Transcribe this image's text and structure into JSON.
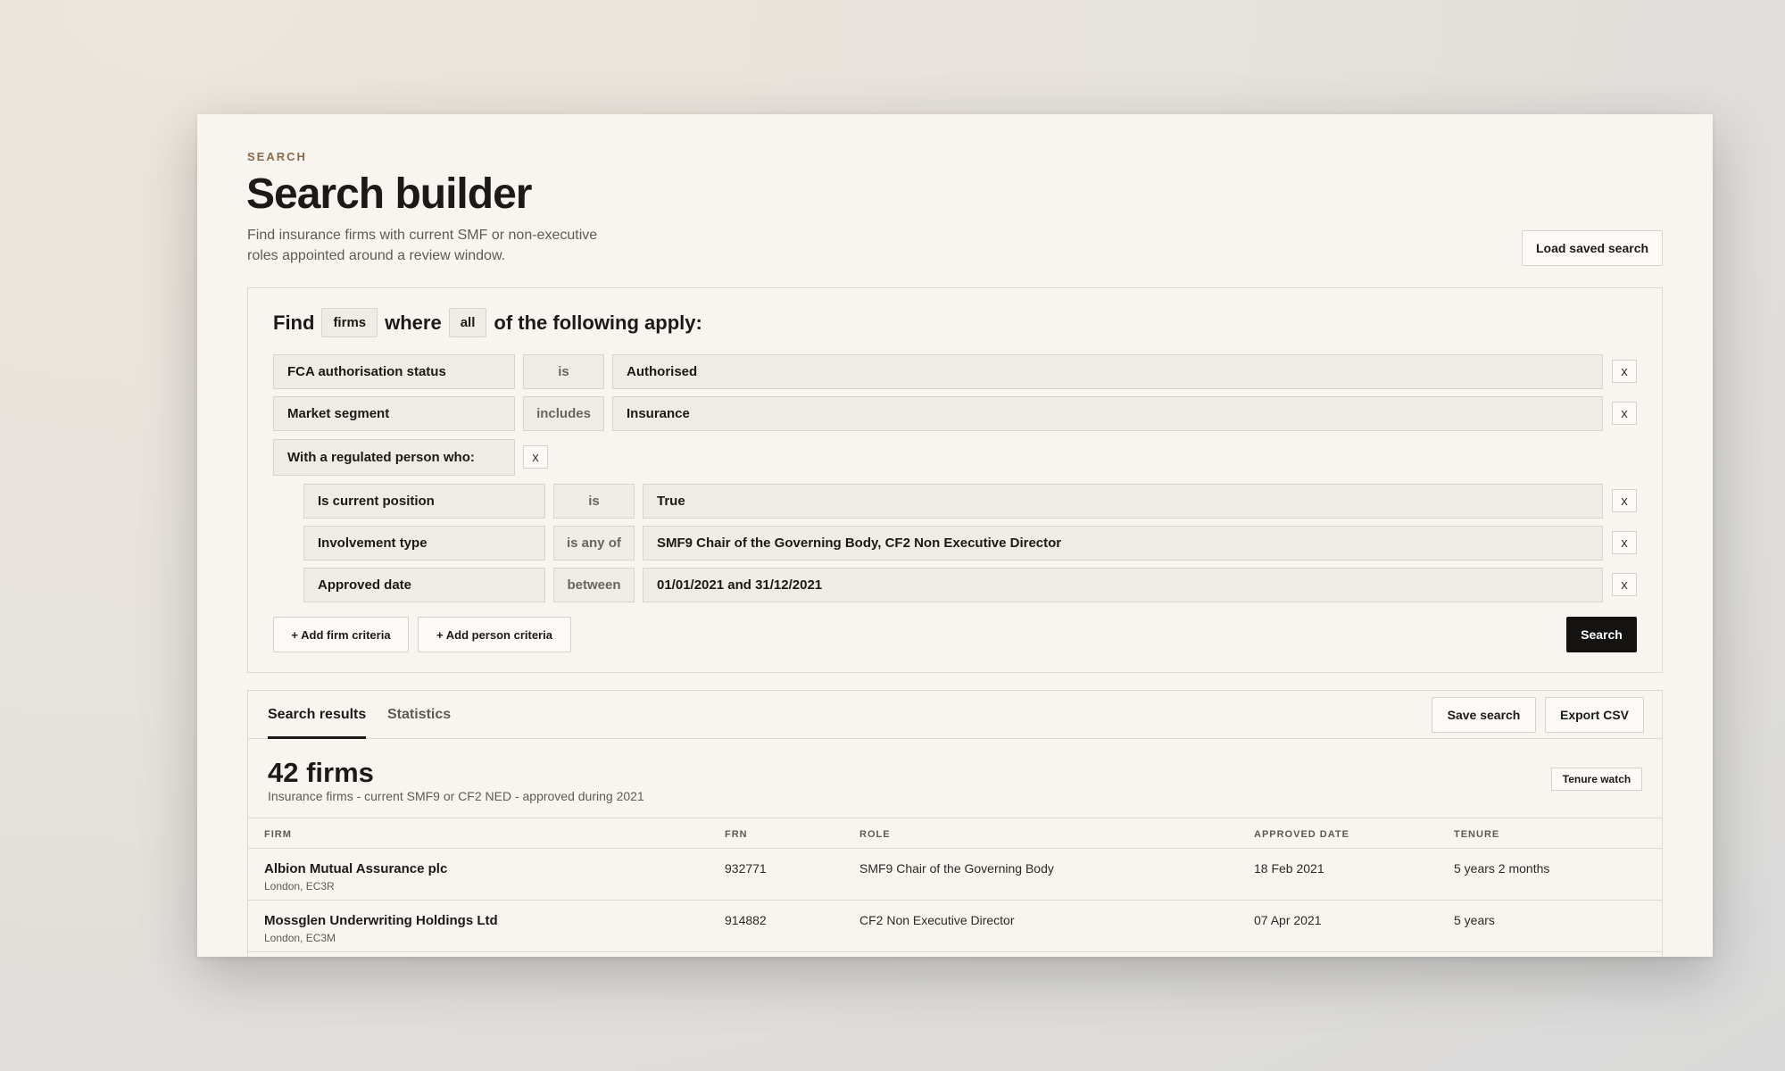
{
  "header": {
    "eyebrow": "SEARCH",
    "title": "Search builder",
    "subtitle": "Find insurance firms with current SMF or non-executive roles appointed around a review window.",
    "load_saved_label": "Load saved search"
  },
  "builder": {
    "find": "Find",
    "entity": "firms",
    "where": "where",
    "quantifier": "all",
    "suffix": "of the following apply:",
    "firm_criteria": [
      {
        "field": "FCA authorisation status",
        "operator": "is",
        "value": "Authorised"
      },
      {
        "field": "Market segment",
        "operator": "includes",
        "value": "Insurance"
      }
    ],
    "group_label": "With a regulated person who:",
    "person_criteria": [
      {
        "field": "Is current position",
        "operator": "is",
        "value": "True"
      },
      {
        "field": "Involvement type",
        "operator": "is any of",
        "value": "SMF9 Chair of the Governing Body, CF2 Non Executive Director"
      },
      {
        "field": "Approved date",
        "operator": "between",
        "value": "01/01/2021 and 31/12/2021"
      }
    ],
    "remove_label": "x",
    "add_firm_label": "+ Add firm criteria",
    "add_person_label": "+ Add person criteria",
    "search_label": "Search"
  },
  "results": {
    "tabs": [
      "Search results",
      "Statistics"
    ],
    "save_label": "Save search",
    "export_label": "Export CSV",
    "count": "42 firms",
    "summary": "Insurance firms - current SMF9 or CF2 NED - approved during 2021",
    "badge": "Tenure watch",
    "columns": [
      "FIRM",
      "FRN",
      "ROLE",
      "APPROVED DATE",
      "TENURE"
    ],
    "rows": [
      {
        "firm": "Albion Mutual Assurance plc",
        "location": "London, EC3R",
        "frn": "932771",
        "role": "SMF9 Chair of the Governing Body",
        "approved": "18 Feb 2021",
        "tenure": "5 years 2 months"
      },
      {
        "firm": "Mossglen Underwriting Holdings Ltd",
        "location": "London, EC3M",
        "frn": "914882",
        "role": "CF2 Non Executive Director",
        "approved": "07 Apr 2021",
        "tenure": "5 years"
      }
    ]
  }
}
